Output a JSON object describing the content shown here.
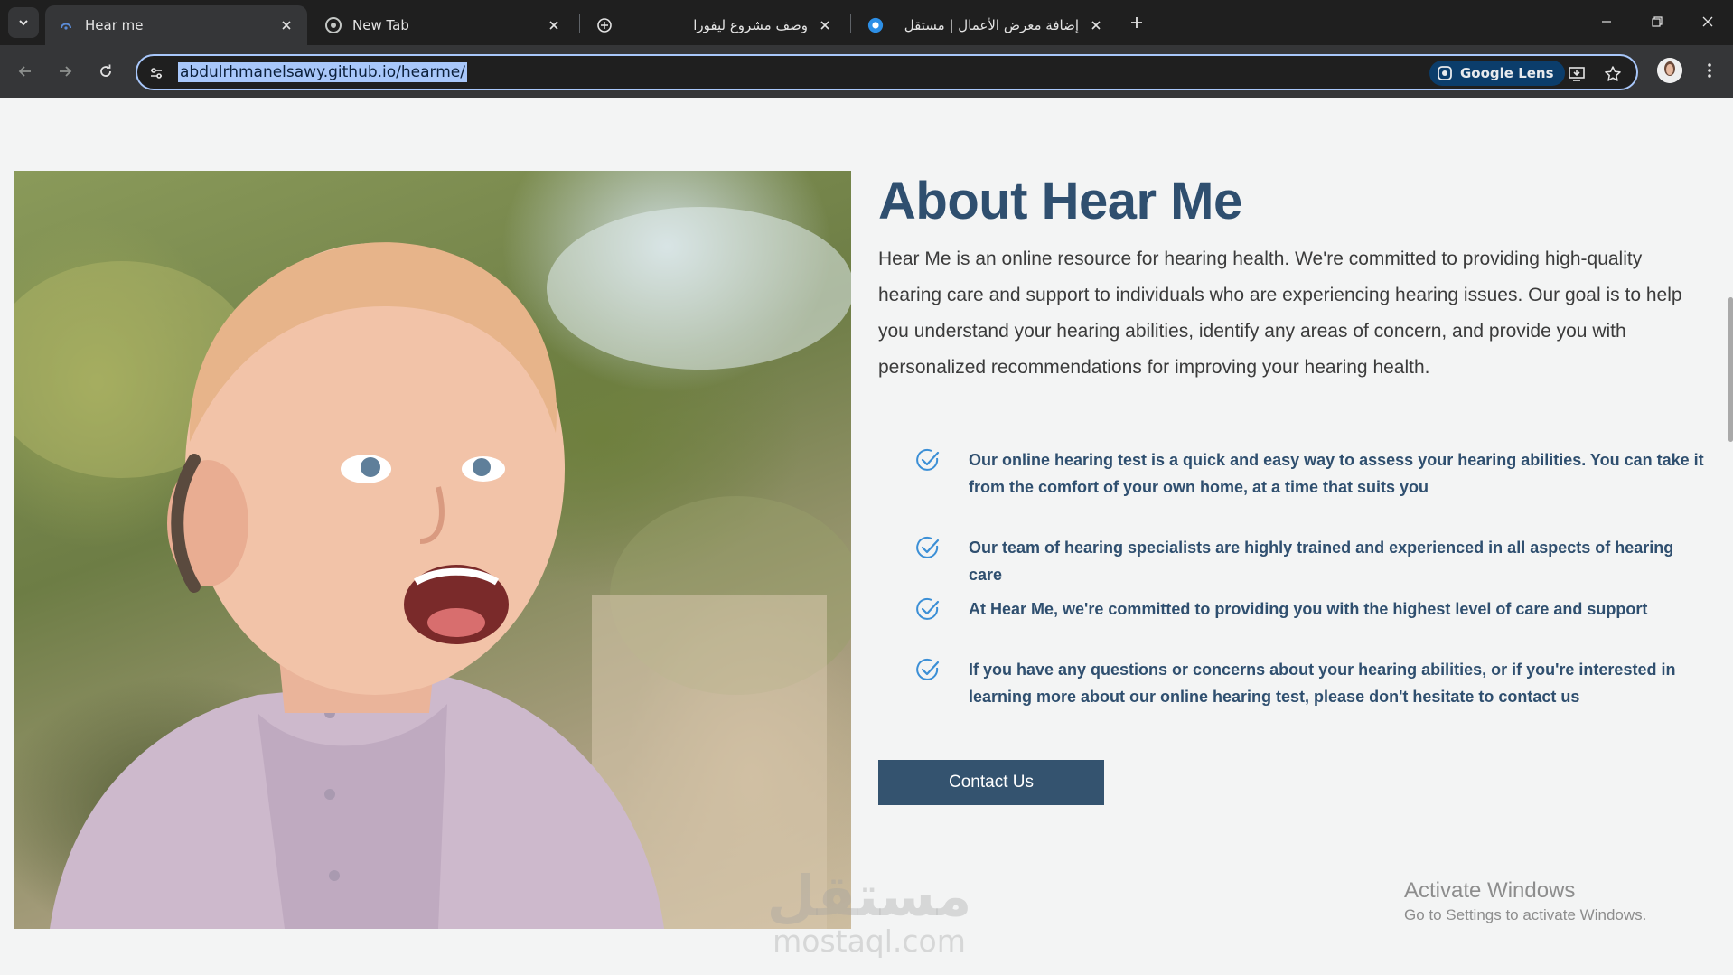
{
  "browser": {
    "tabs": [
      {
        "title": "Hear me",
        "active": true
      },
      {
        "title": "New Tab",
        "active": false
      },
      {
        "title": "وصف مشروع ليفورا",
        "active": false
      },
      {
        "title": "إضافة معرض الأعمال | مستقل",
        "active": false
      }
    ],
    "url": "abdulrhmanelsawy.github.io/hearme/",
    "lens_label": "Google Lens",
    "icons": {
      "tab_search": "chevron-down-icon",
      "new_tab": "plus-icon",
      "back": "arrow-left-icon",
      "forward": "arrow-right-icon",
      "reload": "reload-icon",
      "site_info": "tune-icon",
      "install": "install-app-icon",
      "bookmark": "star-icon",
      "menu": "kebab-menu-icon"
    }
  },
  "about": {
    "title": "About Hear Me",
    "description": "Hear Me is an online resource for hearing health. We're committed to providing high-quality hearing care and support to individuals who are experiencing hearing issues. Our goal is to help you understand your hearing abilities, identify any areas of concern, and provide you with personalized recommendations for improving your hearing health.",
    "features": [
      "Our online hearing test is a quick and easy way to assess your hearing abilities. You can take it from the comfort of your own home, at a time that suits you",
      "Our team of hearing specialists are highly trained and experienced in all aspects of hearing care",
      "At Hear Me, we're committed to providing you with the highest level of care and support",
      "If you have any questions or concerns about your hearing abilities, or if you're interested in learning more about our online hearing test, please don't hesitate to contact us"
    ],
    "contact_button": "Contact Us"
  },
  "watermark": {
    "arabic": "مستقل",
    "latin": "mostaql.com"
  },
  "windows_notice": {
    "line1": "Activate Windows",
    "line2": "Go to Settings to activate Windows."
  },
  "colors": {
    "heading": "#2f4f6f",
    "button": "#34536f",
    "accent_check": "#3b8fd6",
    "page_bg": "#f3f4f4"
  }
}
